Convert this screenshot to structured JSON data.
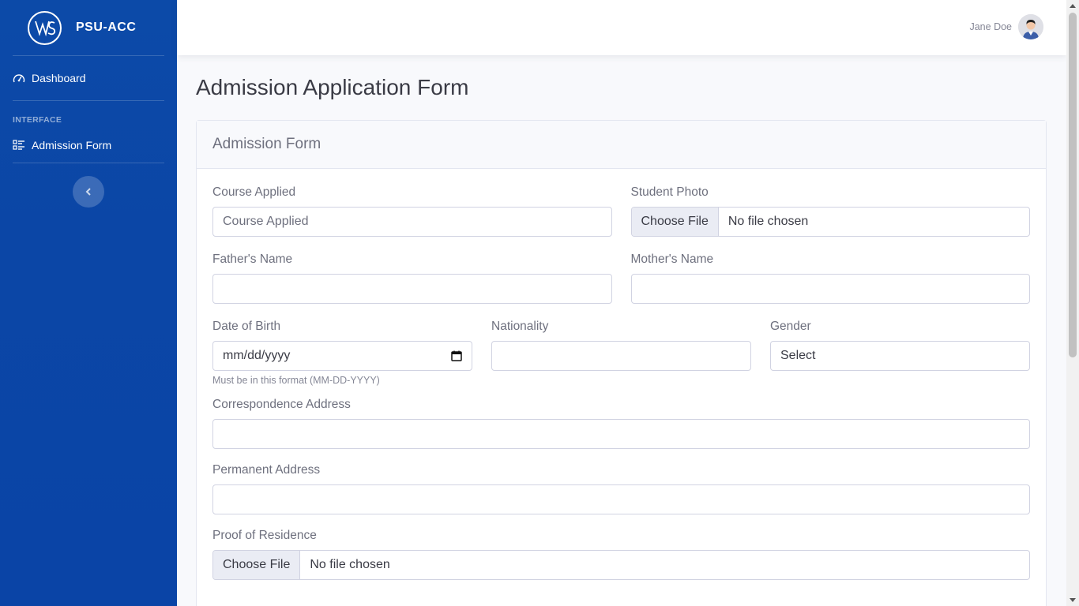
{
  "brand": {
    "name": "PSU-ACC"
  },
  "sidebar": {
    "items": [
      {
        "label": "Dashboard",
        "icon": "gauge-icon"
      },
      {
        "heading": "INTERFACE"
      },
      {
        "label": "Admission Form",
        "icon": "list-check-icon"
      }
    ]
  },
  "topbar": {
    "user_name": "Jane Doe"
  },
  "page": {
    "title": "Admission Application Form"
  },
  "card": {
    "title": "Admission Form"
  },
  "form": {
    "course_applied": {
      "label": "Course Applied",
      "placeholder": "Course Applied"
    },
    "student_photo": {
      "label": "Student Photo",
      "button": "Choose File",
      "status": "No file chosen"
    },
    "fathers_name": {
      "label": "Father's Name",
      "value": ""
    },
    "mothers_name": {
      "label": "Mother's Name",
      "value": ""
    },
    "date_of_birth": {
      "label": "Date of Birth",
      "placeholder": "mm/dd/yyyy",
      "help": "Must be in this format (MM-DD-YYYY)"
    },
    "nationality": {
      "label": "Nationality",
      "value": ""
    },
    "gender": {
      "label": "Gender",
      "selected": "Select"
    },
    "correspondence_address": {
      "label": "Correspondence Address",
      "value": ""
    },
    "permanent_address": {
      "label": "Permanent Address",
      "value": ""
    },
    "proof_of_residence": {
      "label": "Proof of Residence",
      "button": "Choose File",
      "status": "No file chosen"
    }
  },
  "colors": {
    "sidebar": "#0b46a6",
    "background": "#f8f9fc",
    "card_header": "#f8f9fc"
  }
}
